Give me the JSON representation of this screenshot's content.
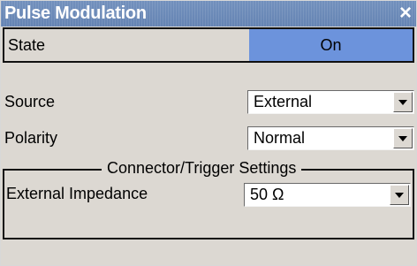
{
  "dialog": {
    "title": "Pulse Modulation",
    "close_icon": "×"
  },
  "state": {
    "label": "State",
    "value": "On"
  },
  "source": {
    "label": "Source",
    "value": "External"
  },
  "polarity": {
    "label": "Polarity",
    "value": "Normal"
  },
  "connector_group": {
    "title": "Connector/Trigger Settings",
    "impedance": {
      "label": "External Impedance",
      "value": "50 Ω"
    }
  },
  "colors": {
    "titlebar": "#6a89b8",
    "toggle_active": "#6c93dc",
    "panel_bg": "#dcd8d2"
  },
  "icons": {
    "close": "close-icon",
    "dropdown": "chevron-down-icon"
  }
}
